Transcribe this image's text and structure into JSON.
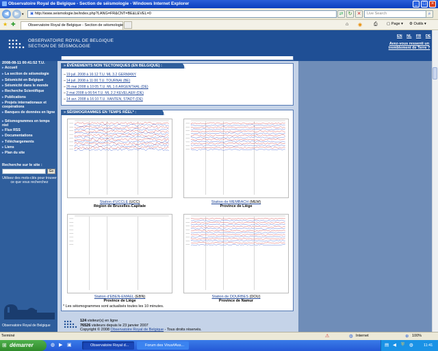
{
  "window": {
    "title": "Observatoire Royal de Belgique - Section de séismologie - Windows Internet Explorer",
    "minimize": "_",
    "maximize": "□",
    "close": "×"
  },
  "addressbar": {
    "url": "http://www.seismologie.be/index.php?LANG=FR&CNT=BE&LEVEL=0",
    "search_placeholder": "Live Search"
  },
  "tabs": [
    {
      "label": "Observatoire Royal de Belgique - Section de séismologie"
    }
  ],
  "toolbar": {
    "page": "Page",
    "tools": "Outils"
  },
  "banner": {
    "line1": "OBSERVATOIRE ROYAL DE BELGIQUE",
    "line2": "SECTION DE SÉISMOLOGIE",
    "languages": [
      "EN",
      "NL",
      "FR",
      "DE"
    ],
    "felt_link": "Avez-vous ressenti un tremblement de Terre ?"
  },
  "sidebar": {
    "datetime": "2008-08-11  00:41:52 T.U.",
    "items": [
      "Accueil",
      "La section de séismologie",
      "Séismicité en Belgique",
      "Séismicité dans le monde",
      "Recherche Scientifique",
      "Publications",
      "Projets internationaux et coopérations",
      "Banques de données en ligne",
      "Séismogrammes en temps réel",
      "Flux RSS",
      "Documentations",
      "Téléchargements",
      "Liens",
      "Plan du site"
    ],
    "search_label": "Recherche sur le site :",
    "go": "Go",
    "help": "Utilisez des mots-clés pour trouver ce que vous recherchez",
    "footer_label": "Observatoire Royal de Belgique"
  },
  "events": {
    "title": "ÉVÉNEMENTS NON TECTONIQUES (EN BELGIQUE) :",
    "items": [
      "19 juil. 2008 à 16:12 T.U. ML 3.2 GERMANY",
      "14 juil. 2008 à 11:00 T.U. TOURNAI (BE)",
      "26 mai 2008 à 10:05 T.U. ML 1.6 ARGENTHAL (DE)",
      "2 mai 2008 à 06:54 T.U. ML 2.2 KEVELAER (DE)",
      "14 avr. 2008 à 16:10 T.U. XANTEN, STADT (DE)"
    ]
  },
  "seismograms": {
    "title": "SÉISMOGRAMMES EN TEMPS RÉEL* :",
    "stations": [
      {
        "link": "Station d'UCCLE",
        "code": "(UCC)",
        "region": "Région de Bruxelles-Capitale"
      },
      {
        "link": "Station de MEMBACH",
        "code": "(MEM)",
        "region": "Province de Liège"
      },
      {
        "link": "Station d'EBEN-EMAEL",
        "code": "(EBN)",
        "region": "Province de Liège"
      },
      {
        "link": "Station de DOURBES",
        "code": "(DOU)",
        "region": "Province de Namur"
      }
    ],
    "note": "* Les séismogrammes sont actualisés toutes les 10 minutes."
  },
  "footer": {
    "visitors_online_count": "124",
    "visitors_online_text": "visiteur(s) en ligne",
    "visitors_total_count": "76526",
    "visitors_total_text": "visiteurs depuis le 23 janvier 2007",
    "copyright_prefix": "Copyright © 2008",
    "copyright_link": "Observatoire Royal de Belgique",
    "copyright_suffix": "- Tous droits réservés."
  },
  "statusbar": {
    "status": "Terminé",
    "zone": "Internet",
    "zoom": "100%"
  },
  "taskbar": {
    "start": "démarrer",
    "tasks": [
      "Observatoire Royal d...",
      "Forum des Virus#Ass..."
    ],
    "clock": "11:41"
  },
  "colors": {
    "banner": "#1f4f95",
    "sidebar": "#2f5e9c",
    "content_bg": "#c5d3e8",
    "link": "#22489a",
    "trace_red": "#d23a3a",
    "trace_blue": "#3a5fd2"
  }
}
